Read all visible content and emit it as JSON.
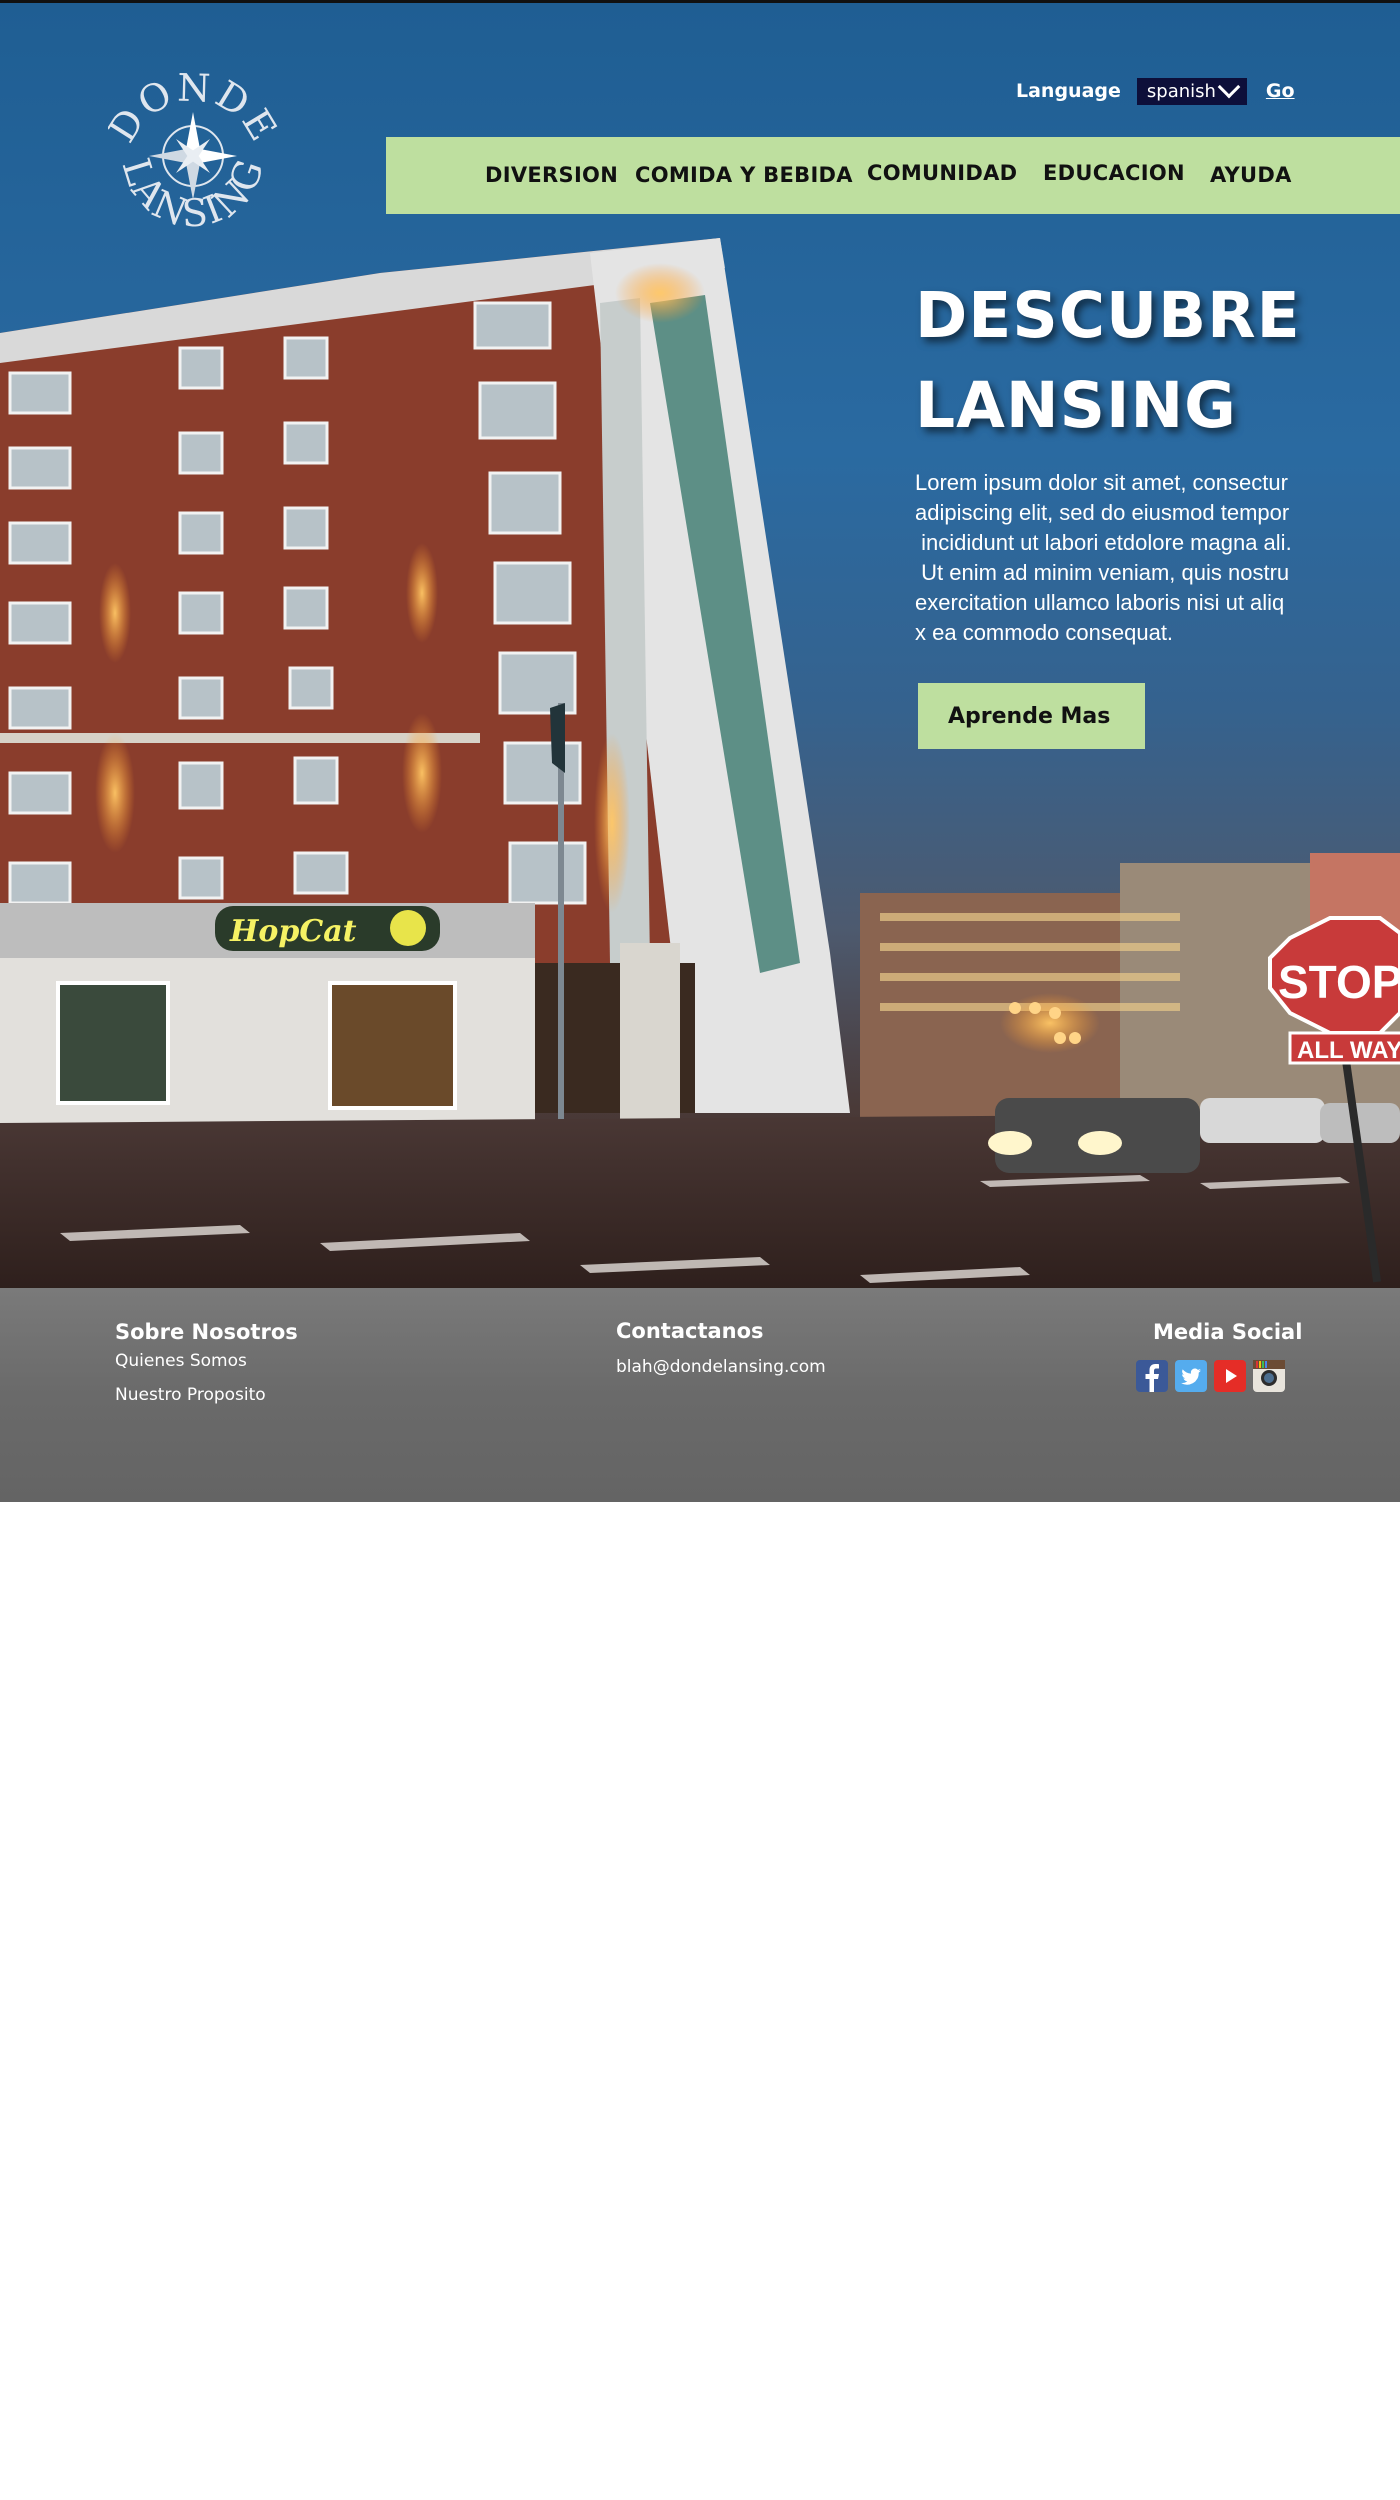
{
  "brand": {
    "logo_top": "DONDE",
    "logo_bottom": "LANSING"
  },
  "language": {
    "label": "Language",
    "selected": "spanish",
    "go": "Go"
  },
  "nav": {
    "items": [
      "DIVERSION",
      "COMIDA Y BEBIDA",
      "COMUNIDAD",
      "EDUCACION",
      "AYUDA"
    ]
  },
  "hero": {
    "title_line1": "DESCUBRE",
    "title_line2": "LANSING",
    "body_lines": [
      "Lorem ipsum dolor sit amet, consectur",
      "adipiscing elit, sed do eiusmod tempor",
      " incididunt ut labori etdolore magna ali.",
      " Ut enim ad minim veniam, quis nostru",
      "exercitation ullamco laboris nisi ut aliq",
      "x ea commodo consequat."
    ],
    "button": "Aprende Mas",
    "scene_signs": {
      "restaurant": "HopCat",
      "stop": "STOP",
      "all_way": "ALL WAY"
    }
  },
  "footer": {
    "about": {
      "heading": "Sobre Nosotros",
      "links": [
        "Quienes Somos",
        "Nuestro Proposito"
      ]
    },
    "contact": {
      "heading": "Contactanos",
      "email": "blah@dondelansing.com"
    },
    "social": {
      "heading": "Media Social",
      "icons": [
        "facebook-icon",
        "twitter-icon",
        "youtube-icon",
        "instagram-icon"
      ]
    }
  },
  "colors": {
    "nav_bg": "#bedf9f",
    "select_bg": "#0d0f3a",
    "footer_bg": "#6a6a6a"
  }
}
